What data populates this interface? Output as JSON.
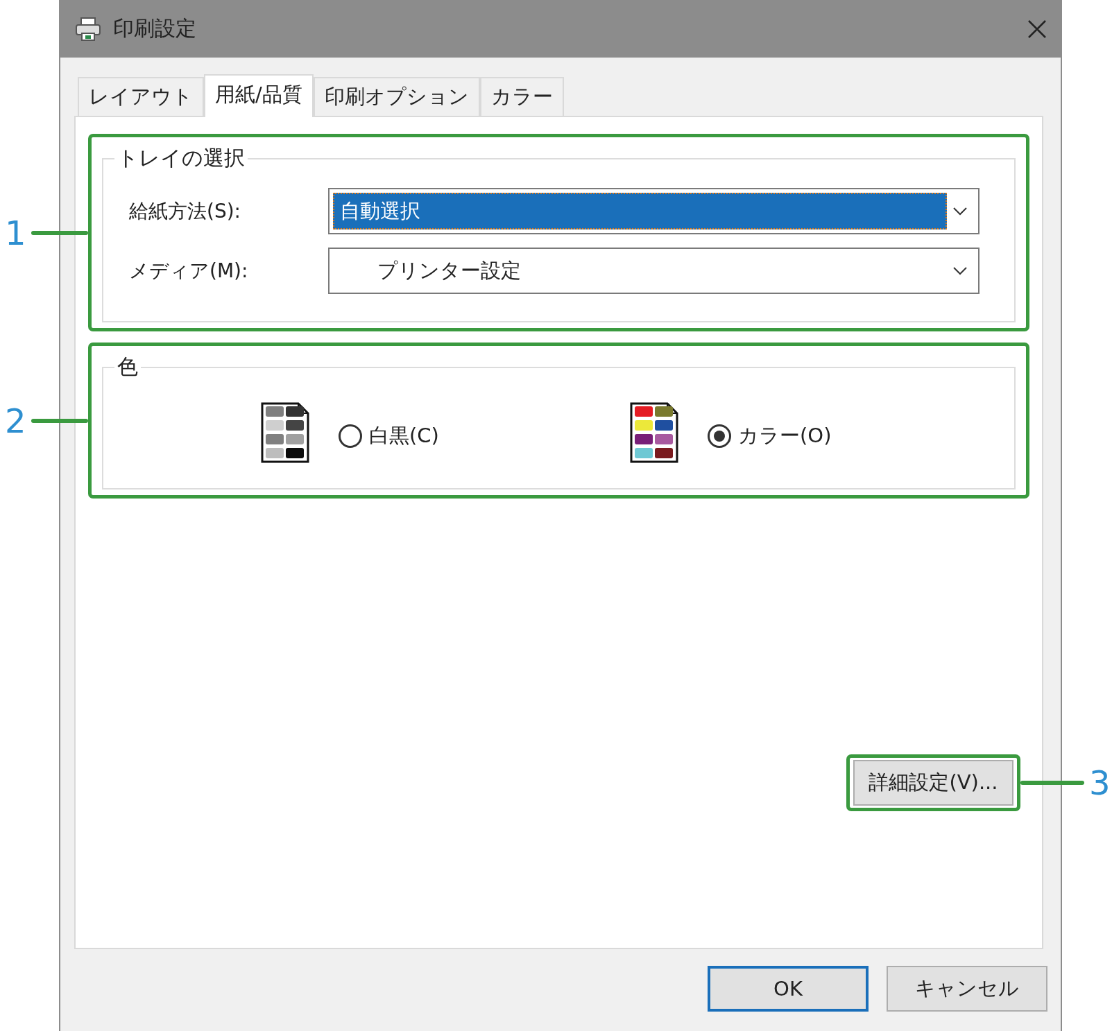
{
  "window": {
    "title": "印刷設定"
  },
  "tabs": [
    {
      "label": "レイアウト",
      "selected": false
    },
    {
      "label": "用紙/品質",
      "selected": true
    },
    {
      "label": "印刷オプション",
      "selected": false
    },
    {
      "label": "カラー",
      "selected": false
    }
  ],
  "tray_group": {
    "title": "トレイの選択",
    "callout": "1",
    "fields": [
      {
        "label": "給紙方法(S):",
        "value": "自動選択",
        "focused": true
      },
      {
        "label": "メディア(M):",
        "value": "プリンター設定",
        "focused": false
      }
    ]
  },
  "color_group": {
    "title": "色",
    "callout": "2",
    "options": [
      {
        "kind": "mono",
        "label": "白黒(C)",
        "selected": false
      },
      {
        "kind": "color",
        "label": "カラー(O)",
        "selected": true
      }
    ]
  },
  "advanced_button": {
    "label": "詳細設定(V)...",
    "callout": "3"
  },
  "buttons": [
    {
      "label": "OK",
      "default": true
    },
    {
      "label": "キャンセル",
      "default": false
    }
  ]
}
